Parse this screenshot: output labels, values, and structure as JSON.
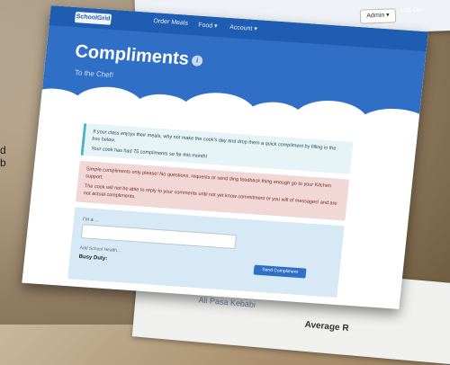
{
  "background": {
    "admin_button": "Admin ▾",
    "logout": "Log Ou",
    "left_letters": "d\nb",
    "bottom_sheet_text_1": "Ali Pasa Kebabi",
    "bottom_sheet_text_2": "Average R"
  },
  "page": {
    "nav": {
      "logo": "SchoolGrid",
      "items": [
        "Order Meals",
        "Food ▾",
        "Account ▾"
      ]
    },
    "title": "Compliments",
    "subtitle": "To the Chef!",
    "alert_info": {
      "line1": "If your class enjoys their meals, why not make the cook's day and drop them a quick compliment by filling in the box below.",
      "line2": "Your cook has had 75 compliments so far this month!"
    },
    "alert_danger": {
      "line1": "Simple compliments only please! No questions, requests or send ding feedback thing enough go to your Kitchen support.",
      "line2": "The cook will not be able to reply to your comments until not yet know commitment or you will of messages! and are not actual compliments."
    },
    "form": {
      "field_label": "I'm a ...",
      "input_value": "",
      "small_note": "Add School Health...",
      "busy_label": "Busy Duty:",
      "send_button": "Send Compliment"
    }
  },
  "colors": {
    "hero_blue": "#2f6fc6",
    "navbar_blue": "#1f5db3",
    "info_bg": "#e7f4f7",
    "danger_bg": "#f2d7d7",
    "panel_bg": "#d6e9f5"
  }
}
